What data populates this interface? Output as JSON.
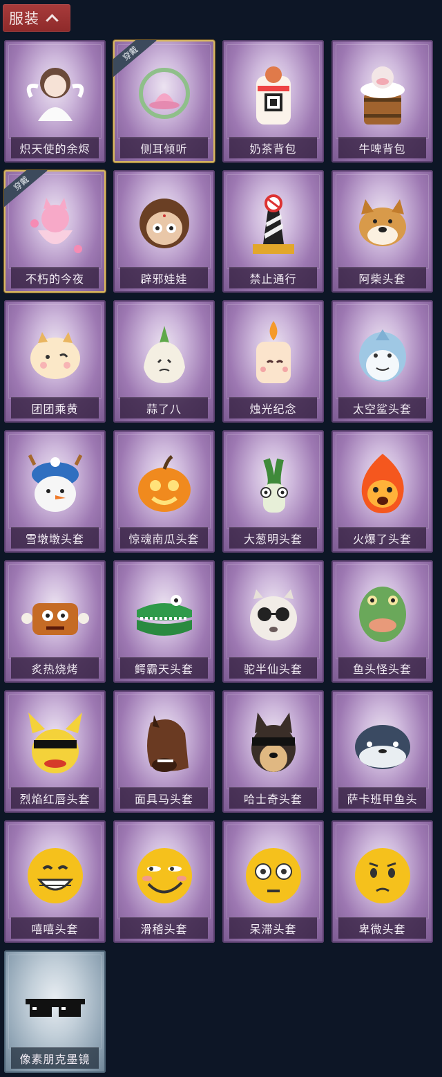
{
  "header": {
    "title": "服装"
  },
  "items": [
    {
      "name": "炽天使的余烬",
      "icon": "angel-doll-icon",
      "worn": false
    },
    {
      "name": "侧耳倾听",
      "icon": "lotus-wreath-icon",
      "worn": true
    },
    {
      "name": "奶茶背包",
      "icon": "milk-tea-backpack-icon",
      "worn": false
    },
    {
      "name": "牛啤背包",
      "icon": "cow-beer-backpack-icon",
      "worn": false
    },
    {
      "name": "不朽的今夜",
      "icon": "pink-fox-bowl-icon",
      "worn": true
    },
    {
      "name": "辟邪娃娃",
      "icon": "doll-head-icon",
      "worn": false
    },
    {
      "name": "禁止通行",
      "icon": "traffic-barrier-icon",
      "worn": false
    },
    {
      "name": "阿柴头套",
      "icon": "shiba-mask-icon",
      "worn": false
    },
    {
      "name": "团团乘黄",
      "icon": "cute-beast-icon",
      "worn": false
    },
    {
      "name": "蒜了八",
      "icon": "garlic-icon",
      "worn": false
    },
    {
      "name": "烛光纪念",
      "icon": "candle-icon",
      "worn": false
    },
    {
      "name": "太空鲨头套",
      "icon": "shark-mask-icon",
      "worn": false
    },
    {
      "name": "雪墩墩头套",
      "icon": "snowman-mask-icon",
      "worn": false
    },
    {
      "name": "惊魂南瓜头套",
      "icon": "pumpkin-mask-icon",
      "worn": false
    },
    {
      "name": "大葱明头套",
      "icon": "scallion-mask-icon",
      "worn": false
    },
    {
      "name": "火爆了头套",
      "icon": "fireball-mask-icon",
      "worn": false
    },
    {
      "name": "炙热烧烤",
      "icon": "bbq-meat-icon",
      "worn": false
    },
    {
      "name": "鳄霸天头套",
      "icon": "crocodile-mask-icon",
      "worn": false
    },
    {
      "name": "驼半仙头套",
      "icon": "alpaca-mask-icon",
      "worn": false
    },
    {
      "name": "鱼头怪头套",
      "icon": "fish-head-mask-icon",
      "worn": false
    },
    {
      "name": "烈焰红唇头套",
      "icon": "yellow-mouse-mask-icon",
      "worn": false
    },
    {
      "name": "面具马头套",
      "icon": "horse-mask-icon",
      "worn": false
    },
    {
      "name": "哈士奇头套",
      "icon": "husky-mask-icon",
      "worn": false
    },
    {
      "name": "萨卡班甲鱼头",
      "icon": "armored-fish-mask-icon",
      "worn": false
    },
    {
      "name": "嘻嘻头套",
      "icon": "grin-emoji-icon",
      "worn": false
    },
    {
      "name": "滑稽头套",
      "icon": "smirk-emoji-icon",
      "worn": false
    },
    {
      "name": "呆滞头套",
      "icon": "flushed-emoji-icon",
      "worn": false
    },
    {
      "name": "卑微头套",
      "icon": "pleading-emoji-icon",
      "worn": false
    },
    {
      "name": "像素朋克墨镜",
      "icon": "pixel-sunglasses-icon",
      "worn": false,
      "tier": "blue"
    }
  ],
  "worn_badge": "穿戴",
  "colors": {
    "background": "#0d1626",
    "header": "#9a3232",
    "card_purple": "#9d78b2",
    "card_blue": "#93a7b7",
    "worn_border": "#d8b860"
  }
}
